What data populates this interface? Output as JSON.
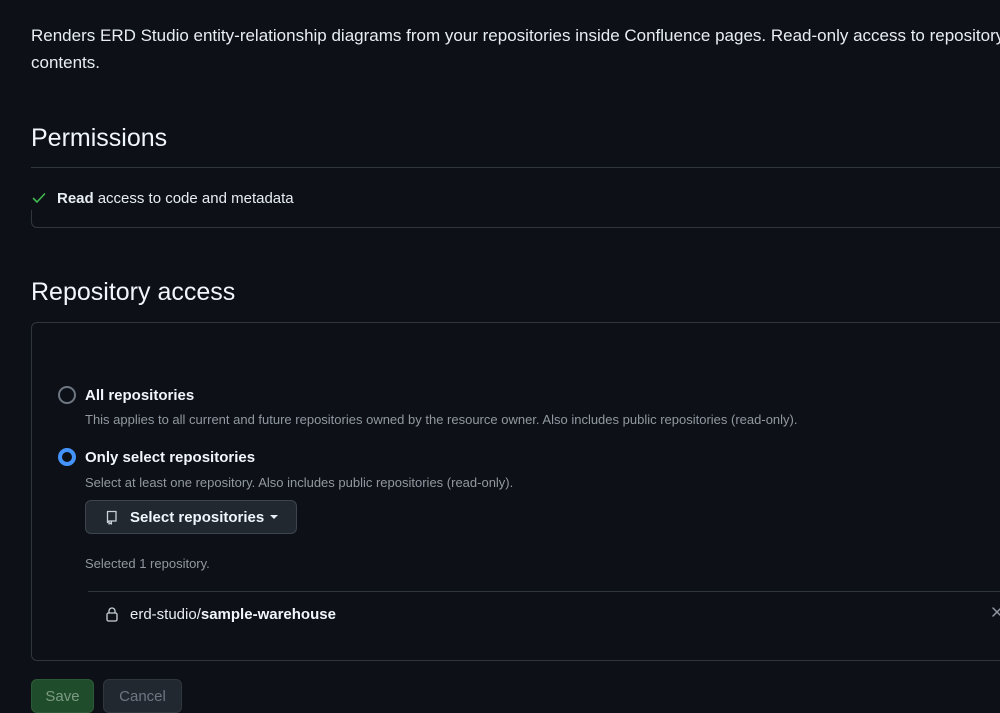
{
  "app": {
    "description": "Renders ERD Studio entity-relationship diagrams from your repositories inside Confluence pages. Read-only access to repository contents."
  },
  "permissions": {
    "title": "Permissions",
    "items": [
      {
        "strong": "Read",
        "rest": "access to code and metadata",
        "icon": "check-icon",
        "icon_color": "#3fb950"
      }
    ]
  },
  "repository_access": {
    "title": "Repository access",
    "options": [
      {
        "label": "All repositories",
        "description": "This applies to all current and future repositories owned by the resource owner. Also includes public repositories (read-only).",
        "checked": false
      },
      {
        "label": "Only select repositories",
        "description": "Select at least one repository. Also includes public repositories (read-only).",
        "checked": true
      }
    ],
    "select_button_label": "Select repositories",
    "selected_count_text": "Selected 1 repository.",
    "selected_repos": [
      {
        "owner": "erd-studio/",
        "name": "sample-warehouse",
        "icon": "lock-icon"
      }
    ]
  },
  "actions": {
    "save_label": "Save",
    "cancel_label": "Cancel"
  },
  "colors": {
    "accent": "#4493f8",
    "success": "#3fb950",
    "background": "#0d1117"
  }
}
